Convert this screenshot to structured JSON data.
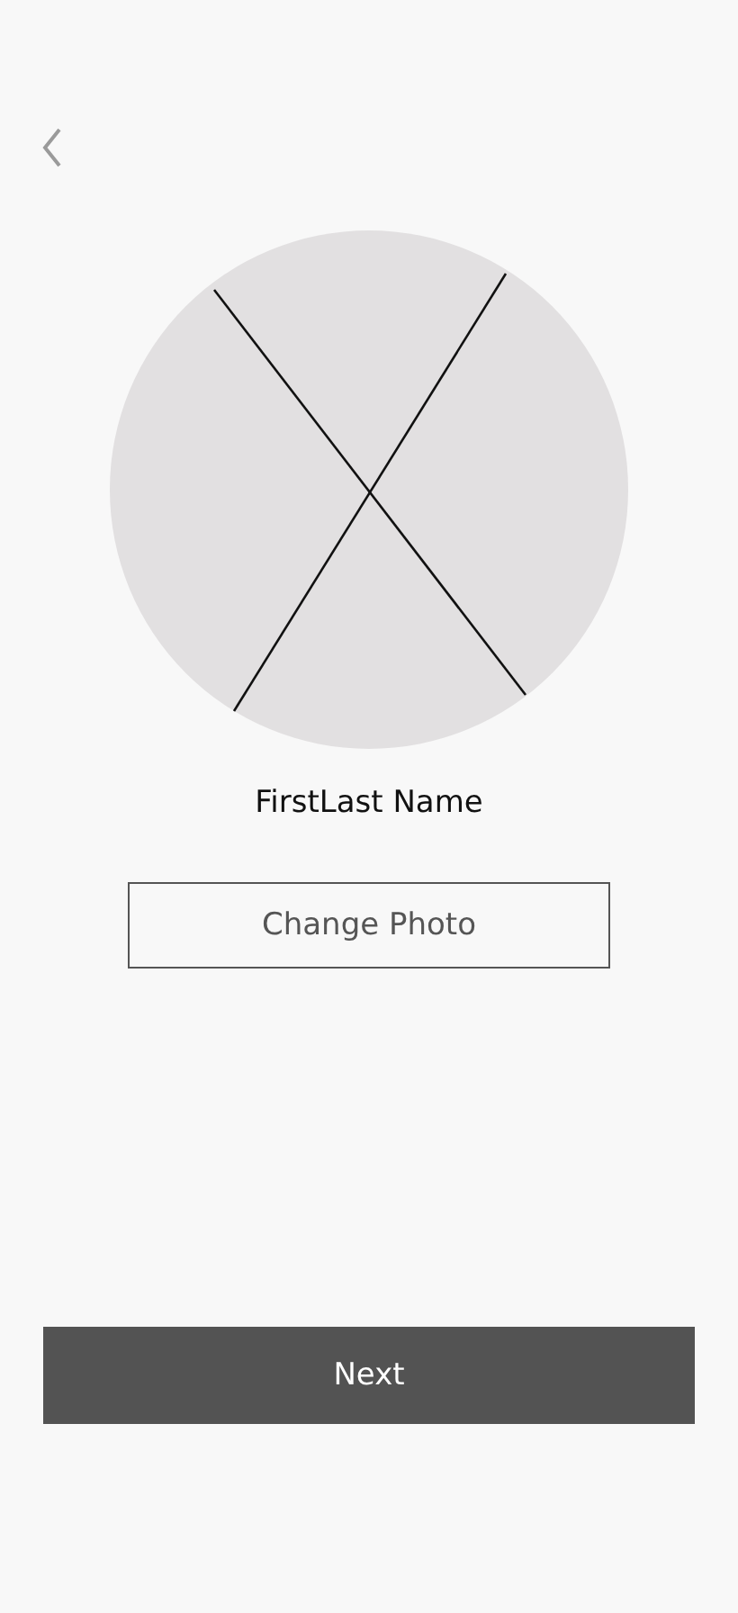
{
  "profile": {
    "name": "FirstLast Name"
  },
  "buttons": {
    "change_photo": "Change Photo",
    "next": "Next"
  }
}
